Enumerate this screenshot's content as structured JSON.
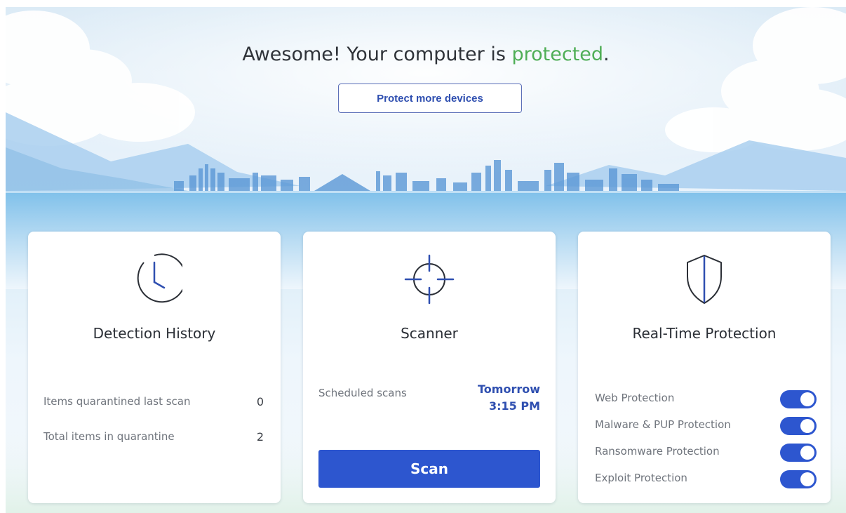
{
  "hero": {
    "title_prefix": "Awesome! Your computer is ",
    "title_status": "protected",
    "title_suffix": ".",
    "protect_button": "Protect more devices"
  },
  "cards": {
    "detection_history": {
      "icon": "clock-icon",
      "title": "Detection History",
      "rows": [
        {
          "label": "Items quarantined last scan",
          "value": "0"
        },
        {
          "label": "Total items in quarantine",
          "value": "2"
        }
      ]
    },
    "scanner": {
      "icon": "crosshair-icon",
      "title": "Scanner",
      "schedule_label": "Scheduled scans",
      "schedule_day": "Tomorrow",
      "schedule_time": "3:15 PM",
      "scan_button": "Scan"
    },
    "realtime_protection": {
      "icon": "shield-icon",
      "title": "Real-Time Protection",
      "toggles": [
        {
          "label": "Web Protection",
          "enabled": true
        },
        {
          "label": "Malware & PUP Protection",
          "enabled": true
        },
        {
          "label": "Ransomware Protection",
          "enabled": true
        },
        {
          "label": "Exploit Protection",
          "enabled": true
        }
      ]
    }
  },
  "colors": {
    "accent_green": "#4fae56",
    "primary_blue": "#2d56cf",
    "link_blue": "#2f4fb0"
  }
}
